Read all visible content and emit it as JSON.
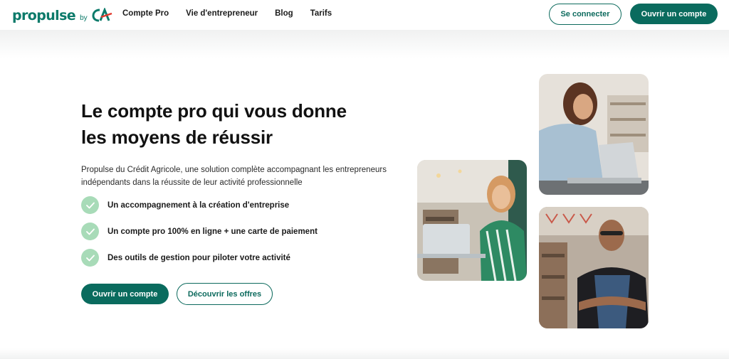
{
  "header": {
    "logo_word": "propulse",
    "logo_by": "by",
    "nav": [
      "Compte Pro",
      "Vie d'entrepreneur",
      "Blog",
      "Tarifs"
    ],
    "connect_label": "Se connecter",
    "open_account_label": "Ouvrir un compte"
  },
  "hero": {
    "title_line1": "Le compte pro qui vous donne",
    "title_line2": "les moyens de réussir",
    "description": "Propulse du Crédit Agricole, une solution complète accompagnant les entrepreneurs indépendants dans la réussite de leur activité professionnelle",
    "features": [
      "Un accompagnement à la création d'entreprise",
      "Un compte pro 100% en ligne + une carte de paiement",
      "Des outils de gestion pour piloter votre activité"
    ],
    "primary_button": "Ouvrir un compte",
    "secondary_button": "Découvrir les offres"
  },
  "colors": {
    "brand_green": "#0a6b5e",
    "check_green": "#a8dbb8"
  }
}
